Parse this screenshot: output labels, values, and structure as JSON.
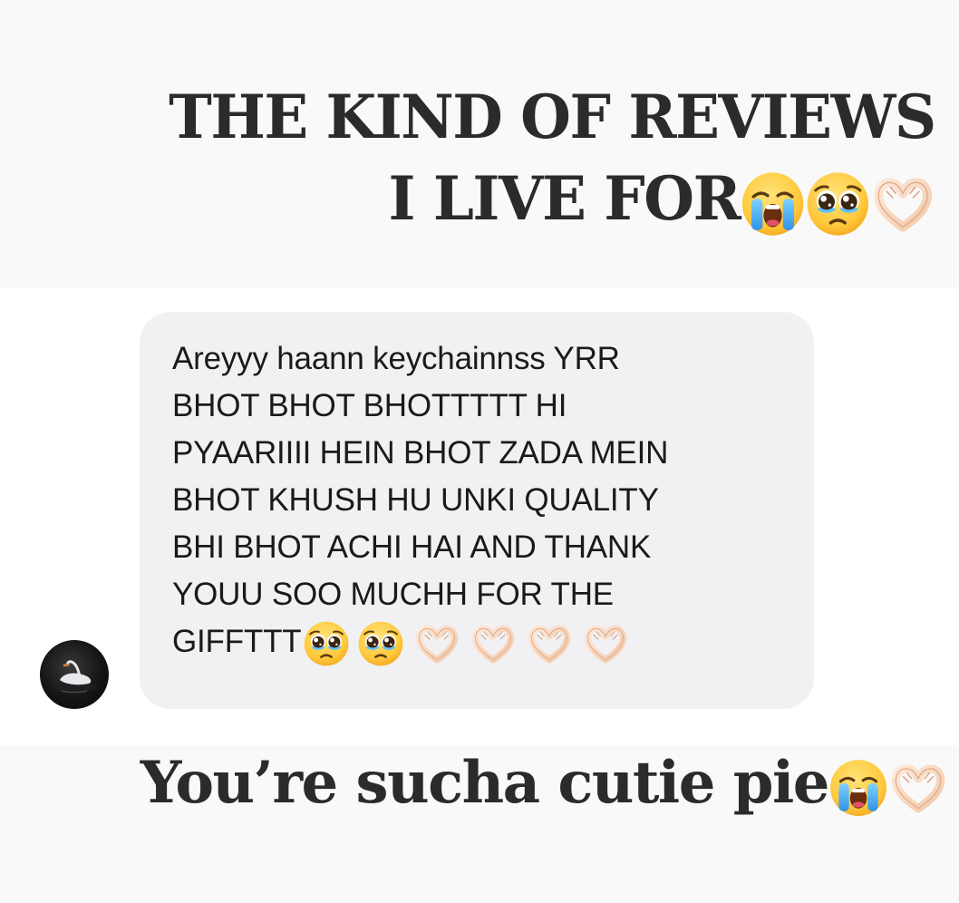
{
  "headline": {
    "line1": "THE KIND OF REVIEWS",
    "line2": "I LIVE FOR",
    "emojis": [
      "loudly-crying-face",
      "pleading-face",
      "heart-hands"
    ]
  },
  "message": {
    "lines": [
      "Areyyy haann keychainnss YRR",
      "BHOT BHOT BHOTTTTT HI",
      "PYAARIIII HEIN BHOT ZADA MEIN",
      "BHOT KHUSH HU UNKI QUALITY",
      "BHI BHOT ACHI HAI AND THANK",
      "YOUU SOO MUCHH FOR THE",
      "GIFFTTT"
    ],
    "trailing_emojis": [
      "pleading-face",
      "pleading-face",
      "heart-hands",
      "heart-hands",
      "heart-hands",
      "heart-hands"
    ],
    "bubble_color": "#f1f1f3"
  },
  "avatar": {
    "icon": "swan-icon"
  },
  "footer": {
    "text": "You’re sucha cutie pie",
    "emojis": [
      "loudly-crying-face",
      "heart-hands"
    ]
  },
  "colors": {
    "text_dark": "#2b2b2b",
    "band_background": "#f9f9f9",
    "page_background": "#ffffff"
  }
}
